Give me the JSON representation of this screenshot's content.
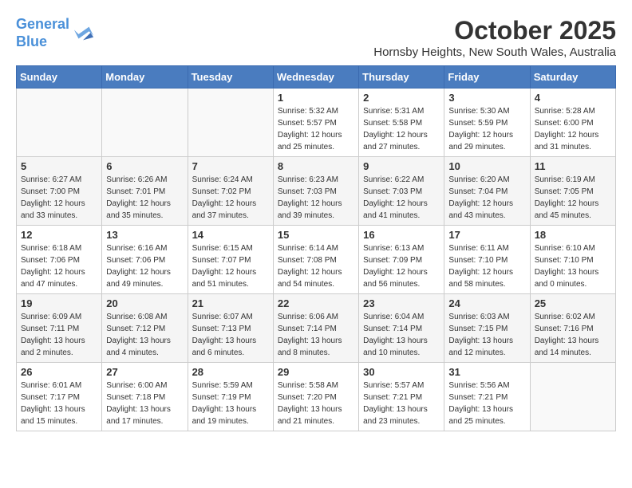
{
  "logo": {
    "line1": "General",
    "line2": "Blue"
  },
  "title": "October 2025",
  "location": "Hornsby Heights, New South Wales, Australia",
  "days_of_week": [
    "Sunday",
    "Monday",
    "Tuesday",
    "Wednesday",
    "Thursday",
    "Friday",
    "Saturday"
  ],
  "weeks": [
    [
      {
        "day": "",
        "info": ""
      },
      {
        "day": "",
        "info": ""
      },
      {
        "day": "",
        "info": ""
      },
      {
        "day": "1",
        "info": "Sunrise: 5:32 AM\nSunset: 5:57 PM\nDaylight: 12 hours\nand 25 minutes."
      },
      {
        "day": "2",
        "info": "Sunrise: 5:31 AM\nSunset: 5:58 PM\nDaylight: 12 hours\nand 27 minutes."
      },
      {
        "day": "3",
        "info": "Sunrise: 5:30 AM\nSunset: 5:59 PM\nDaylight: 12 hours\nand 29 minutes."
      },
      {
        "day": "4",
        "info": "Sunrise: 5:28 AM\nSunset: 6:00 PM\nDaylight: 12 hours\nand 31 minutes."
      }
    ],
    [
      {
        "day": "5",
        "info": "Sunrise: 6:27 AM\nSunset: 7:00 PM\nDaylight: 12 hours\nand 33 minutes."
      },
      {
        "day": "6",
        "info": "Sunrise: 6:26 AM\nSunset: 7:01 PM\nDaylight: 12 hours\nand 35 minutes."
      },
      {
        "day": "7",
        "info": "Sunrise: 6:24 AM\nSunset: 7:02 PM\nDaylight: 12 hours\nand 37 minutes."
      },
      {
        "day": "8",
        "info": "Sunrise: 6:23 AM\nSunset: 7:03 PM\nDaylight: 12 hours\nand 39 minutes."
      },
      {
        "day": "9",
        "info": "Sunrise: 6:22 AM\nSunset: 7:03 PM\nDaylight: 12 hours\nand 41 minutes."
      },
      {
        "day": "10",
        "info": "Sunrise: 6:20 AM\nSunset: 7:04 PM\nDaylight: 12 hours\nand 43 minutes."
      },
      {
        "day": "11",
        "info": "Sunrise: 6:19 AM\nSunset: 7:05 PM\nDaylight: 12 hours\nand 45 minutes."
      }
    ],
    [
      {
        "day": "12",
        "info": "Sunrise: 6:18 AM\nSunset: 7:06 PM\nDaylight: 12 hours\nand 47 minutes."
      },
      {
        "day": "13",
        "info": "Sunrise: 6:16 AM\nSunset: 7:06 PM\nDaylight: 12 hours\nand 49 minutes."
      },
      {
        "day": "14",
        "info": "Sunrise: 6:15 AM\nSunset: 7:07 PM\nDaylight: 12 hours\nand 51 minutes."
      },
      {
        "day": "15",
        "info": "Sunrise: 6:14 AM\nSunset: 7:08 PM\nDaylight: 12 hours\nand 54 minutes."
      },
      {
        "day": "16",
        "info": "Sunrise: 6:13 AM\nSunset: 7:09 PM\nDaylight: 12 hours\nand 56 minutes."
      },
      {
        "day": "17",
        "info": "Sunrise: 6:11 AM\nSunset: 7:10 PM\nDaylight: 12 hours\nand 58 minutes."
      },
      {
        "day": "18",
        "info": "Sunrise: 6:10 AM\nSunset: 7:10 PM\nDaylight: 13 hours\nand 0 minutes."
      }
    ],
    [
      {
        "day": "19",
        "info": "Sunrise: 6:09 AM\nSunset: 7:11 PM\nDaylight: 13 hours\nand 2 minutes."
      },
      {
        "day": "20",
        "info": "Sunrise: 6:08 AM\nSunset: 7:12 PM\nDaylight: 13 hours\nand 4 minutes."
      },
      {
        "day": "21",
        "info": "Sunrise: 6:07 AM\nSunset: 7:13 PM\nDaylight: 13 hours\nand 6 minutes."
      },
      {
        "day": "22",
        "info": "Sunrise: 6:06 AM\nSunset: 7:14 PM\nDaylight: 13 hours\nand 8 minutes."
      },
      {
        "day": "23",
        "info": "Sunrise: 6:04 AM\nSunset: 7:14 PM\nDaylight: 13 hours\nand 10 minutes."
      },
      {
        "day": "24",
        "info": "Sunrise: 6:03 AM\nSunset: 7:15 PM\nDaylight: 13 hours\nand 12 minutes."
      },
      {
        "day": "25",
        "info": "Sunrise: 6:02 AM\nSunset: 7:16 PM\nDaylight: 13 hours\nand 14 minutes."
      }
    ],
    [
      {
        "day": "26",
        "info": "Sunrise: 6:01 AM\nSunset: 7:17 PM\nDaylight: 13 hours\nand 15 minutes."
      },
      {
        "day": "27",
        "info": "Sunrise: 6:00 AM\nSunset: 7:18 PM\nDaylight: 13 hours\nand 17 minutes."
      },
      {
        "day": "28",
        "info": "Sunrise: 5:59 AM\nSunset: 7:19 PM\nDaylight: 13 hours\nand 19 minutes."
      },
      {
        "day": "29",
        "info": "Sunrise: 5:58 AM\nSunset: 7:20 PM\nDaylight: 13 hours\nand 21 minutes."
      },
      {
        "day": "30",
        "info": "Sunrise: 5:57 AM\nSunset: 7:21 PM\nDaylight: 13 hours\nand 23 minutes."
      },
      {
        "day": "31",
        "info": "Sunrise: 5:56 AM\nSunset: 7:21 PM\nDaylight: 13 hours\nand 25 minutes."
      },
      {
        "day": "",
        "info": ""
      }
    ]
  ]
}
